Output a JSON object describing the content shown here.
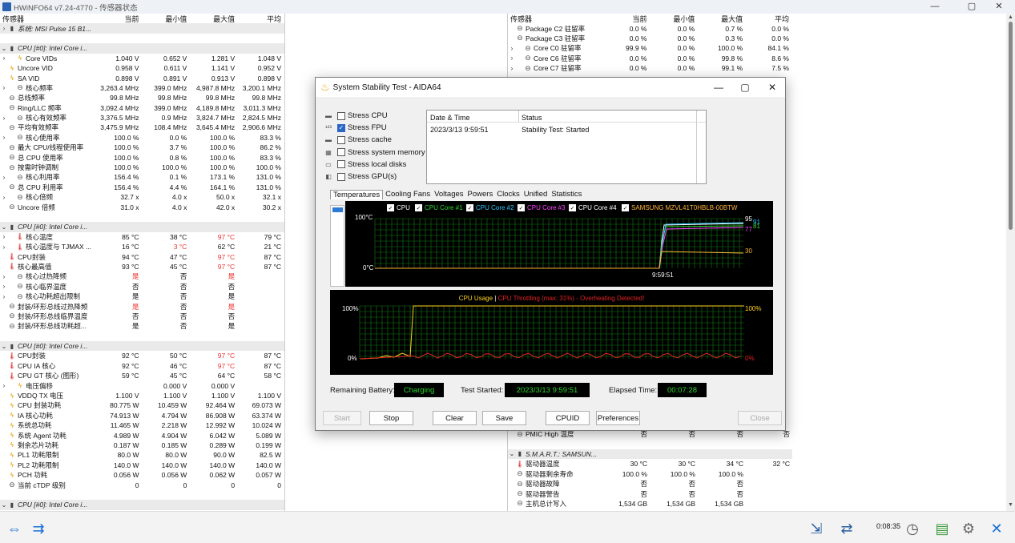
{
  "window": {
    "title": "HWiNFO64 v7.24-4770 - 传感器状态",
    "minimize": "—",
    "maximize": "▢",
    "close": "✕"
  },
  "left_panel": {
    "headers": [
      "传感器",
      "当前",
      "最小值",
      "最大值",
      "平均"
    ],
    "rows": [
      {
        "e": ">",
        "i": "chip",
        "l": "系统: MSI Pulse 15 B1...",
        "g": true,
        "v": [
          "",
          "",
          "",
          ""
        ]
      },
      {
        "e": "",
        "i": "",
        "l": "",
        "v": [
          "",
          "",
          "",
          ""
        ]
      },
      {
        "e": "v",
        "i": "chip",
        "l": "CPU [#0]: Intel Core i...",
        "g": true,
        "v": [
          "",
          "",
          "",
          ""
        ]
      },
      {
        "e": ">",
        "i": "bolt",
        "l": "Core VIDs",
        "ind": 1,
        "v": [
          "1.040 V",
          "0.652 V",
          "1.281 V",
          "1.048 V"
        ]
      },
      {
        "e": "",
        "i": "bolt",
        "l": "Uncore VID",
        "v": [
          "0.958 V",
          "0.611 V",
          "1.141 V",
          "0.952 V"
        ]
      },
      {
        "e": "",
        "i": "bolt",
        "l": "SA VID",
        "v": [
          "0.898 V",
          "0.891 V",
          "0.913 V",
          "0.898 V"
        ]
      },
      {
        "e": ">",
        "i": "circ",
        "l": "核心频率",
        "ind": 1,
        "v": [
          "3,263.4 MHz",
          "399.0 MHz",
          "4,987.8 MHz",
          "3,200.1 MHz"
        ]
      },
      {
        "e": "",
        "i": "circ",
        "l": "总线频率",
        "v": [
          "99.8 MHz",
          "99.8 MHz",
          "99.8 MHz",
          "99.8 MHz"
        ]
      },
      {
        "e": "",
        "i": "circ",
        "l": "Ring/LLC 频率",
        "v": [
          "3,092.4 MHz",
          "399.0 MHz",
          "4,189.8 MHz",
          "3,011.3 MHz"
        ]
      },
      {
        "e": ">",
        "i": "circ",
        "l": "核心有效频率",
        "ind": 1,
        "v": [
          "3,376.5 MHz",
          "0.9 MHz",
          "3,824.7 MHz",
          "2,824.5 MHz"
        ]
      },
      {
        "e": "",
        "i": "circ",
        "l": "平均有效频率",
        "v": [
          "3,475.9 MHz",
          "108.4 MHz",
          "3,645.4 MHz",
          "2,906.6 MHz"
        ]
      },
      {
        "e": ">",
        "i": "circ",
        "l": "核心使用率",
        "ind": 1,
        "v": [
          "100.0 %",
          "0.0 %",
          "100.0 %",
          "83.3 %"
        ]
      },
      {
        "e": "",
        "i": "circ",
        "l": "最大 CPU/线程使用率",
        "v": [
          "100.0 %",
          "3.7 %",
          "100.0 %",
          "86.2 %"
        ]
      },
      {
        "e": "",
        "i": "circ",
        "l": "总 CPU 使用率",
        "v": [
          "100.0 %",
          "0.8 %",
          "100.0 %",
          "83.3 %"
        ]
      },
      {
        "e": "",
        "i": "circ",
        "l": "按需时钟调制",
        "v": [
          "100.0 %",
          "100.0 %",
          "100.0 %",
          "100.0 %"
        ]
      },
      {
        "e": ">",
        "i": "circ",
        "l": "核心利用率",
        "ind": 1,
        "v": [
          "156.4 %",
          "0.1 %",
          "173.1 %",
          "131.0 %"
        ]
      },
      {
        "e": "",
        "i": "circ",
        "l": "总 CPU 利用率",
        "v": [
          "156.4 %",
          "4.4 %",
          "164.1 %",
          "131.0 %"
        ]
      },
      {
        "e": ">",
        "i": "circ",
        "l": "核心倍频",
        "ind": 1,
        "v": [
          "32.7 x",
          "4.0 x",
          "50.0 x",
          "32.1 x"
        ]
      },
      {
        "e": "",
        "i": "circ",
        "l": "Uncore 倍频",
        "v": [
          "31.0 x",
          "4.0 x",
          "42.0 x",
          "30.2 x"
        ]
      },
      {
        "e": "",
        "i": "",
        "l": "",
        "v": [
          "",
          "",
          "",
          ""
        ]
      },
      {
        "e": "v",
        "i": "chip",
        "l": "CPU [#0]: Intel Core i...",
        "g": true,
        "v": [
          "",
          "",
          "",
          ""
        ]
      },
      {
        "e": ">",
        "i": "therm",
        "l": "核心温度",
        "ind": 1,
        "v": [
          "85 °C",
          "38 °C",
          "97 °C",
          "79 °C"
        ],
        "r": [
          2
        ]
      },
      {
        "e": ">",
        "i": "therm",
        "l": "核心温度与 TJMAX ...",
        "ind": 1,
        "v": [
          "16 °C",
          "3 °C",
          "62 °C",
          "21 °C"
        ],
        "r": [
          1
        ]
      },
      {
        "e": "",
        "i": "therm",
        "l": "CPU封装",
        "v": [
          "94 °C",
          "47 °C",
          "97 °C",
          "87 °C"
        ],
        "r": [
          2
        ]
      },
      {
        "e": "",
        "i": "therm",
        "l": "核心最高值",
        "v": [
          "93 °C",
          "45 °C",
          "97 °C",
          "87 °C"
        ],
        "r": [
          2
        ]
      },
      {
        "e": ">",
        "i": "circ",
        "l": "核心过热降频",
        "ind": 1,
        "v": [
          "是",
          "否",
          "是",
          ""
        ],
        "r": [
          0,
          2
        ]
      },
      {
        "e": ">",
        "i": "circ",
        "l": "核心临界温度",
        "ind": 1,
        "v": [
          "否",
          "否",
          "否",
          ""
        ]
      },
      {
        "e": ">",
        "i": "circ",
        "l": "核心功耗超出限制",
        "ind": 1,
        "v": [
          "是",
          "否",
          "是",
          ""
        ]
      },
      {
        "e": "",
        "i": "circ",
        "l": "封装/环形总线过热降频",
        "v": [
          "是",
          "否",
          "是",
          ""
        ],
        "r": [
          0,
          2
        ]
      },
      {
        "e": "",
        "i": "circ",
        "l": "封装/环形总线临界温度",
        "v": [
          "否",
          "否",
          "否",
          ""
        ]
      },
      {
        "e": "",
        "i": "circ",
        "l": "封装/环形总线功耗超...",
        "v": [
          "是",
          "否",
          "是",
          ""
        ]
      },
      {
        "e": "",
        "i": "",
        "l": "",
        "v": [
          "",
          "",
          "",
          ""
        ]
      },
      {
        "e": "v",
        "i": "chip",
        "l": "CPU [#0]: Intel Core i...",
        "g": true,
        "v": [
          "",
          "",
          "",
          ""
        ]
      },
      {
        "e": "",
        "i": "therm",
        "l": "CPU封装",
        "v": [
          "92 °C",
          "50 °C",
          "97 °C",
          "87 °C"
        ],
        "r": [
          2
        ]
      },
      {
        "e": "",
        "i": "therm",
        "l": "CPU IA 核心",
        "v": [
          "92 °C",
          "46 °C",
          "97 °C",
          "87 °C"
        ],
        "r": [
          2
        ]
      },
      {
        "e": "",
        "i": "therm",
        "l": "CPU GT 核心 (图形)",
        "v": [
          "59 °C",
          "45 °C",
          "64 °C",
          "58 °C"
        ]
      },
      {
        "e": ">",
        "i": "bolt",
        "l": "电压偏移",
        "ind": 1,
        "v": [
          "",
          "0.000 V",
          "0.000 V",
          ""
        ]
      },
      {
        "e": "",
        "i": "bolt",
        "l": "VDDQ TX 电压",
        "v": [
          "1.100 V",
          "1.100 V",
          "1.100 V",
          "1.100 V"
        ]
      },
      {
        "e": "",
        "i": "bolt",
        "l": "CPU 封装功耗",
        "v": [
          "80.775 W",
          "10.459 W",
          "92.464 W",
          "69.073 W"
        ]
      },
      {
        "e": "",
        "i": "bolt",
        "l": "IA 核心功耗",
        "v": [
          "74.913 W",
          "4.794 W",
          "86.908 W",
          "63.374 W"
        ]
      },
      {
        "e": "",
        "i": "bolt",
        "l": "系统总功耗",
        "v": [
          "11.465 W",
          "2.218 W",
          "12.992 W",
          "10.024 W"
        ]
      },
      {
        "e": "",
        "i": "bolt",
        "l": "系统 Agent 功耗",
        "v": [
          "4.989 W",
          "4.904 W",
          "6.042 W",
          "5.089 W"
        ]
      },
      {
        "e": "",
        "i": "bolt",
        "l": "剩余芯片功耗",
        "v": [
          "0.187 W",
          "0.185 W",
          "0.289 W",
          "0.199 W"
        ]
      },
      {
        "e": "",
        "i": "bolt",
        "l": "PL1 功耗限制",
        "v": [
          "80.0 W",
          "80.0 W",
          "90.0 W",
          "82.5 W"
        ]
      },
      {
        "e": "",
        "i": "bolt",
        "l": "PL2 功耗限制",
        "v": [
          "140.0 W",
          "140.0 W",
          "140.0 W",
          "140.0 W"
        ]
      },
      {
        "e": "",
        "i": "bolt",
        "l": "PCH 功耗",
        "v": [
          "0.056 W",
          "0.056 W",
          "0.062 W",
          "0.057 W"
        ]
      },
      {
        "e": "",
        "i": "circ",
        "l": "当前 cTDP 级别",
        "v": [
          "0",
          "0",
          "0",
          "0"
        ]
      },
      {
        "e": "",
        "i": "",
        "l": "",
        "v": [
          "",
          "",
          "",
          ""
        ]
      },
      {
        "e": "v",
        "i": "chip",
        "l": "CPU [#0]: Intel Core i...",
        "g": true,
        "v": [
          "",
          "",
          "",
          ""
        ]
      }
    ]
  },
  "right_panel": {
    "headers": [
      "传感器",
      "当前",
      "最小值",
      "最大值",
      "平均"
    ],
    "rows_top": [
      {
        "e": "",
        "i": "circ",
        "l": "Package C2 驻留率",
        "v": [
          "0.0 %",
          "0.0 %",
          "0.7 %",
          "0.0 %"
        ]
      },
      {
        "e": "",
        "i": "circ",
        "l": "Package C3 驻留率",
        "v": [
          "0.0 %",
          "0.0 %",
          "0.3 %",
          "0.0 %"
        ]
      },
      {
        "e": ">",
        "i": "circ",
        "l": "Core C0 驻留率",
        "ind": 1,
        "v": [
          "99.9 %",
          "0.0 %",
          "100.0 %",
          "84.1 %"
        ]
      },
      {
        "e": ">",
        "i": "circ",
        "l": "Core C6 驻留率",
        "ind": 1,
        "v": [
          "0.0 %",
          "0.0 %",
          "99.8 %",
          "8.6 %"
        ]
      },
      {
        "e": ">",
        "i": "circ",
        "l": "Core C7 驻留率",
        "ind": 1,
        "v": [
          "0.0 %",
          "0.0 %",
          "99.1 %",
          "7.5 %"
        ]
      }
    ],
    "rows_bottom": [
      {
        "e": "",
        "i": "circ",
        "l": "PMIC High 温度",
        "v": [
          "否",
          "否",
          "否",
          "否"
        ]
      },
      {
        "e": "",
        "i": "",
        "l": "",
        "v": [
          "",
          "",
          "",
          ""
        ]
      },
      {
        "e": "v",
        "i": "chip",
        "l": "S.M.A.R.T.: SAMSUN...",
        "g": true,
        "v": [
          "",
          "",
          "",
          ""
        ]
      },
      {
        "e": "",
        "i": "therm",
        "l": "驱动器温度",
        "v": [
          "30 °C",
          "30 °C",
          "34 °C",
          "32 °C"
        ]
      },
      {
        "e": "",
        "i": "circ",
        "l": "驱动器剩余寿命",
        "v": [
          "100.0 %",
          "100.0 %",
          "100.0 %",
          ""
        ]
      },
      {
        "e": "",
        "i": "circ",
        "l": "驱动器故障",
        "v": [
          "否",
          "否",
          "否",
          ""
        ]
      },
      {
        "e": "",
        "i": "circ",
        "l": "驱动器警告",
        "v": [
          "否",
          "否",
          "否",
          ""
        ]
      },
      {
        "e": "",
        "i": "circ",
        "l": "主机总计写入",
        "v": [
          "1,534 GB",
          "1,534 GB",
          "1,534 GB",
          ""
        ]
      }
    ]
  },
  "bottom_bar": {
    "elapsed": "0:08:35"
  },
  "dialog": {
    "title": "System Stability Test - AIDA64",
    "minimize": "—",
    "maximize": "▢",
    "close": "✕",
    "stress": [
      {
        "label": "Stress CPU",
        "checked": false
      },
      {
        "label": "Stress FPU",
        "checked": true
      },
      {
        "label": "Stress cache",
        "checked": false
      },
      {
        "label": "Stress system memory",
        "checked": false
      },
      {
        "label": "Stress local disks",
        "checked": false
      },
      {
        "label": "Stress GPU(s)",
        "checked": false
      }
    ],
    "log": {
      "col1": "Date & Time",
      "col2": "Status",
      "date": "2023/3/13 9:59:51",
      "status": "Stability Test: Started"
    },
    "tabs": [
      "Temperatures",
      "Cooling Fans",
      "Voltages",
      "Powers",
      "Clocks",
      "Unified",
      "Statistics"
    ],
    "temp_graph": {
      "legend": [
        {
          "label": "CPU",
          "color": "#ffffff"
        },
        {
          "label": "CPU Core #1",
          "color": "#2ed52e"
        },
        {
          "label": "CPU Core #2",
          "color": "#2ec8ff"
        },
        {
          "label": "CPU Core #3",
          "color": "#ff44ff"
        },
        {
          "label": "CPU Core #4",
          "color": "#ffffff"
        },
        {
          "label": "SAMSUNG MZVL41T0HBLB-00BTW",
          "color": "#ffb43a"
        }
      ],
      "y_top": "100°C",
      "y_bottom": "0°C",
      "time": "9:59:51",
      "right_vals": [
        "95",
        "91",
        "81",
        "77",
        "30"
      ]
    },
    "usage_graph": {
      "title_usage": "CPU Usage",
      "sep": "|",
      "title_throttle": "CPU Throttling (max: 31%) - Overheating Detected!",
      "left_top": "100%",
      "left_bottom": "0%",
      "right_top": "100%",
      "right_bottom": "0%"
    },
    "info": {
      "battery_label": "Remaining Battery:",
      "battery_value": "Charging",
      "started_label": "Test Started:",
      "started_value": "2023/3/13 9:59:51",
      "elapsed_label": "Elapsed Time:",
      "elapsed_value": "00:07:28"
    },
    "buttons": {
      "start": "Start",
      "stop": "Stop",
      "clear": "Clear",
      "save": "Save",
      "cpuid": "CPUID",
      "preferences": "Preferences",
      "close": "Close"
    }
  },
  "colors": {
    "accent": "#2b66c6",
    "graph_green": "#2ed52e",
    "alert_red": "#e33"
  }
}
